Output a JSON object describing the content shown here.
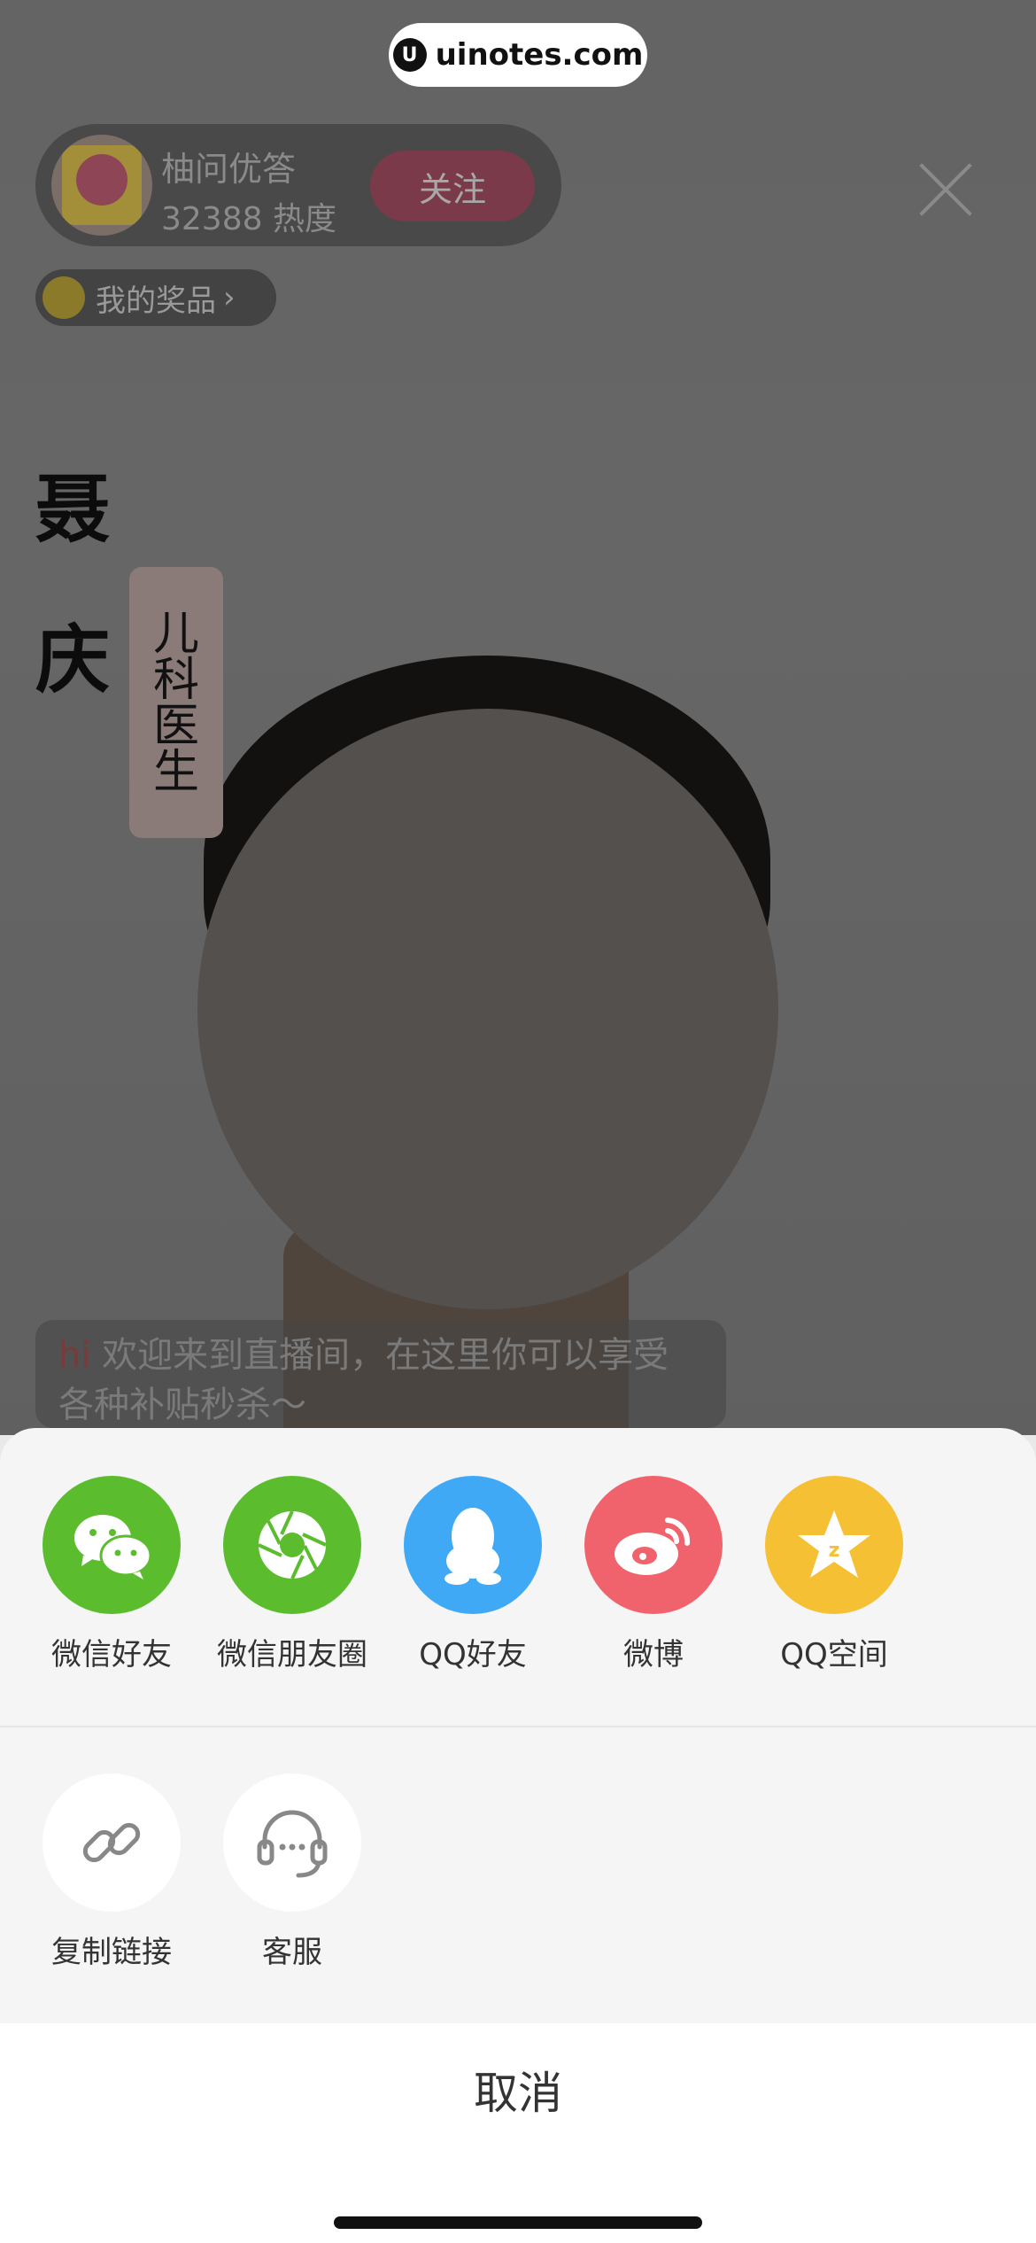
{
  "watermark": {
    "text": "uinotes.com",
    "logo": "U"
  },
  "host": {
    "name": "柚问优答",
    "heat": "32388 热度",
    "follow_label": "关注"
  },
  "prize": {
    "label": "我的奖品",
    "chevron": "›"
  },
  "doctor": {
    "name_char1": "聂",
    "name_char2": "庆",
    "title_chars": [
      "儿",
      "科",
      "医",
      "生"
    ]
  },
  "welcome": {
    "prefix": "hi",
    "message": " 欢迎来到直播间，在这里你可以享受各种补贴秒杀～"
  },
  "share": {
    "row1": [
      {
        "label": "微信好友",
        "icon": "wechat-icon"
      },
      {
        "label": "微信朋友圈",
        "icon": "moments-icon"
      },
      {
        "label": "QQ好友",
        "icon": "qq-icon"
      },
      {
        "label": "微博",
        "icon": "weibo-icon"
      },
      {
        "label": "QQ空间",
        "icon": "qzone-icon"
      }
    ],
    "row2": [
      {
        "label": "复制链接",
        "icon": "link-icon"
      },
      {
        "label": "客服",
        "icon": "headset-icon"
      }
    ],
    "cancel_label": "取消"
  },
  "colors": {
    "wechat": "#5bbd2e",
    "qq": "#3fa9f5",
    "weibo": "#f0636c",
    "qzone": "#f6c035"
  }
}
